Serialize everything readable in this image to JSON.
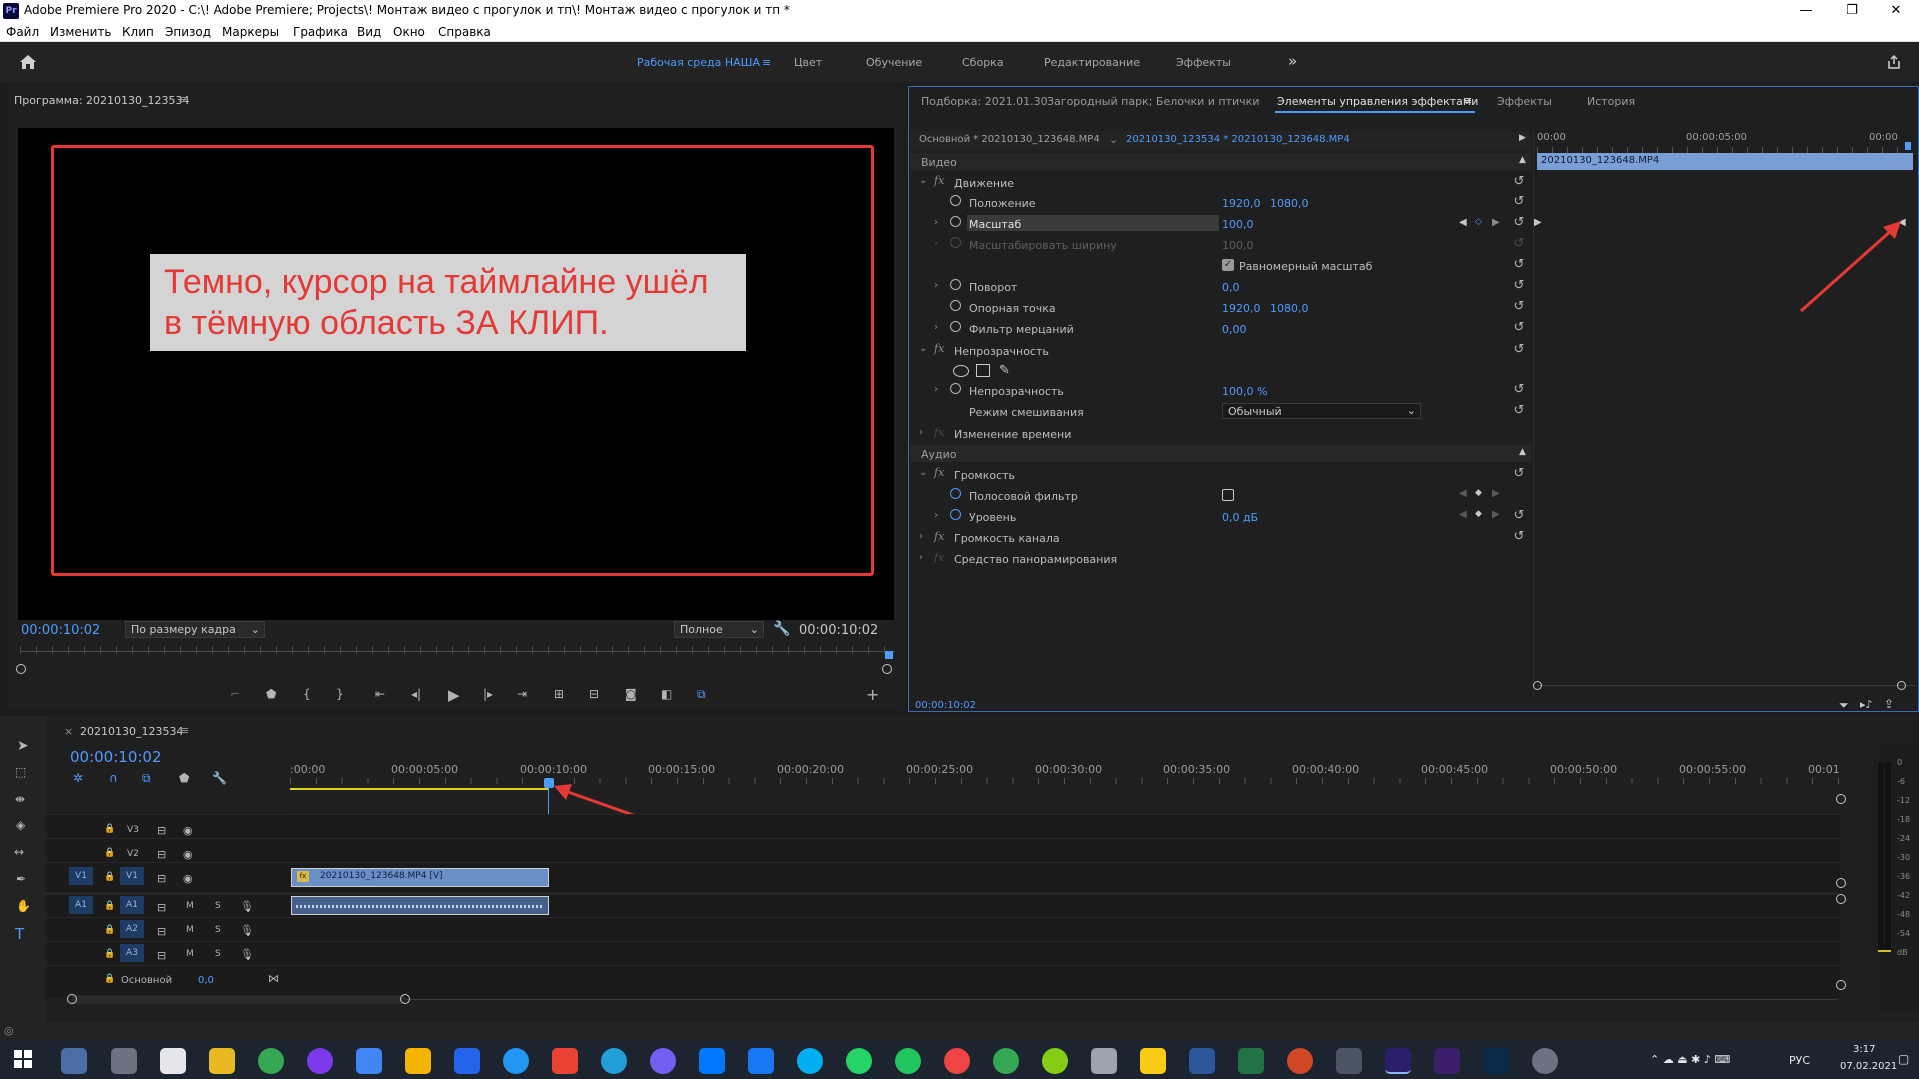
{
  "window": {
    "app_logo": "Pr",
    "title": "Adobe Premiere Pro 2020 - C:\\! Adobe Premiere; Projects\\! Монтаж видео с прогулок и тп\\! Монтаж видео с прогулок и тп *",
    "minimize": "—",
    "maximize": "❐",
    "close": "✕"
  },
  "menu": [
    "Файл",
    "Изменить",
    "Клип",
    "Эпизод",
    "Маркеры",
    "Графика",
    "Вид",
    "Окно",
    "Справка"
  ],
  "workspaces": {
    "active": "Рабочая среда НАША",
    "items": [
      "Цвет",
      "Обучение",
      "Сборка",
      "Редактирование",
      "Эффекты"
    ],
    "more": "»"
  },
  "program_monitor": {
    "title": "Программа: 20210130_123534",
    "annotation": "Темно, курсор на таймлайне ушёл в тёмную область ЗА КЛИП.",
    "timecode_left": "00:00:10:02",
    "fit_select": "По размеру кадра",
    "quality_select": "Полное",
    "timecode_right": "00:00:10:02"
  },
  "effect_controls": {
    "tabs": [
      "Подборка: 2021.01.30",
      "Загородный парк; Белочки и птички",
      "Элементы управления эффектами",
      "Эффекты",
      "История"
    ],
    "active_tab": "Элементы управления эффектами",
    "source_label": "Основной * 20210130_123648.MP4",
    "sequence_label": "20210130_123534 * 20210130_123648.MP4",
    "ruler": [
      "00:00",
      "00:00:05:00",
      "00:00"
    ],
    "clip_name": "20210130_123648.MP4",
    "section_video": "Видео",
    "motion": "Движение",
    "position_label": "Положение",
    "position_x": "1920,0",
    "position_y": "1080,0",
    "scale_label": "Масштаб",
    "scale_value": "100,0",
    "scale_width_label": "Масштабировать ширину",
    "scale_width_value": "100,0",
    "uniform_label": "Равномерный масштаб",
    "rotation_label": "Поворот",
    "rotation_value": "0,0",
    "anchor_label": "Опорная точка",
    "anchor_x": "1920,0",
    "anchor_y": "1080,0",
    "flicker_label": "Фильтр мерцаний",
    "flicker_value": "0,00",
    "opacity": "Непрозрачность",
    "opacity_label": "Непрозрачность",
    "opacity_value": "100,0 %",
    "blend_label": "Режим смешивания",
    "blend_value": "Обычный",
    "time_remap": "Изменение времени",
    "section_audio": "Аудио",
    "volume": "Громкость",
    "bypass_label": "Полосовой фильтр",
    "level_label": "Уровень",
    "level_value": "0,0 дБ",
    "channel_volume": "Громкость канала",
    "panner": "Средство панорамирования",
    "bottom_timecode": "00:00:10:02"
  },
  "timeline": {
    "sequence_name": "20210130_123534",
    "timecode": "00:00:10:02",
    "ruler": [
      ":00:00",
      "00:00:05:00",
      "00:00:10:00",
      "00:00:15:00",
      "00:00:20:00",
      "00:00:25:00",
      "00:00:30:00",
      "00:00:35:00",
      "00:00:40:00",
      "00:00:45:00",
      "00:00:50:00",
      "00:00:55:00",
      "00:01"
    ],
    "video_tracks": [
      "V3",
      "V2",
      "V1"
    ],
    "audio_tracks": [
      "A1",
      "A2",
      "A3"
    ],
    "src_v": "V1",
    "src_a": "A1",
    "master_label": "Основной",
    "master_value": "0,0",
    "clip_name": "20210130_123648.MP4 [V]",
    "mute": "M",
    "solo": "S"
  },
  "audio_meter": {
    "scale": [
      "0",
      "-6",
      "-12",
      "-18",
      "-24",
      "-30",
      "-36",
      "-42",
      "-48",
      "-54",
      "dB"
    ]
  },
  "taskbar": {
    "lang": "РУС",
    "time": "3:17",
    "date": "07.02.2021"
  },
  "colors": {
    "accent": "#4d9cff",
    "annotation_red": "#e53935",
    "playhead": "#4d9cff"
  }
}
